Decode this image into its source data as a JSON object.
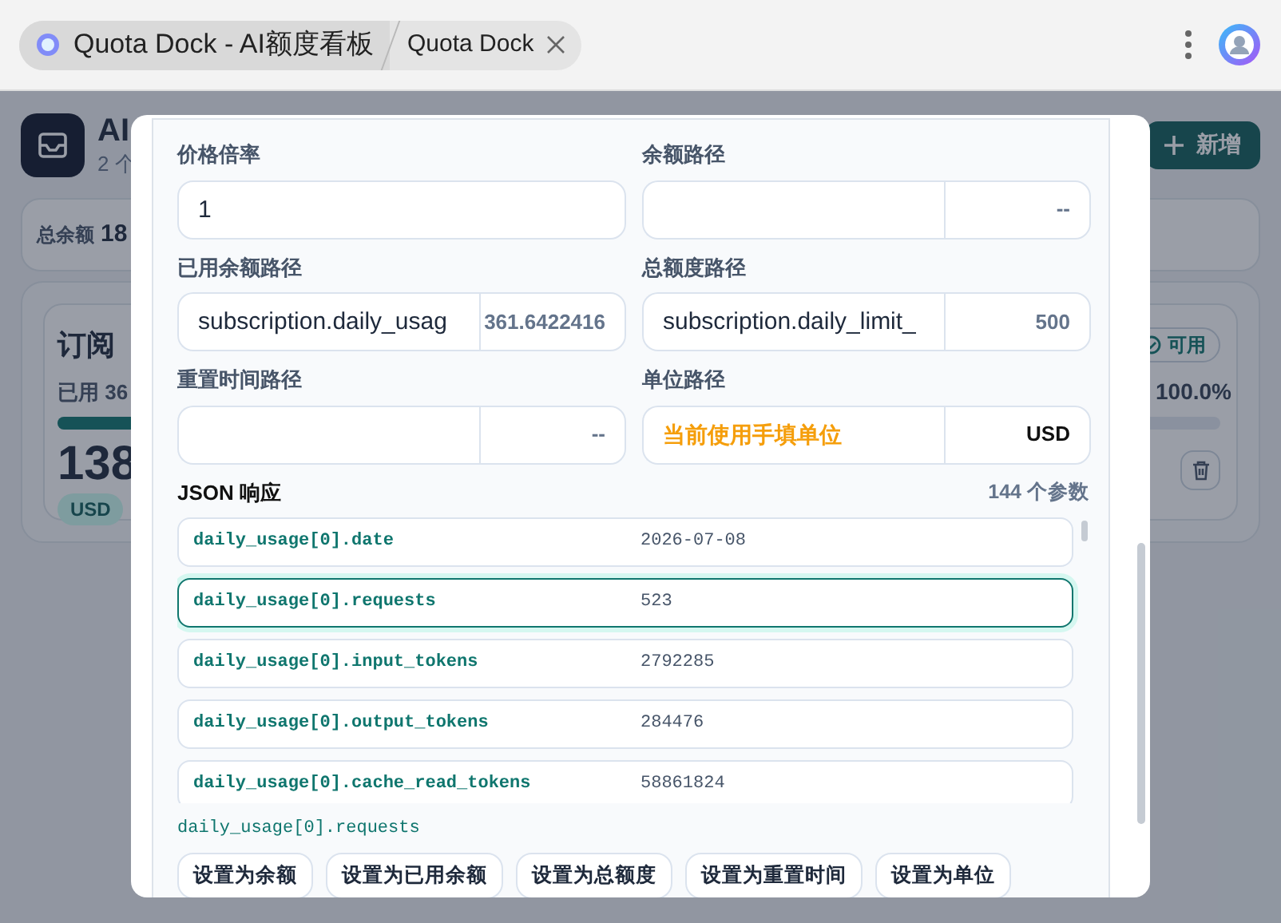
{
  "browser": {
    "tabs": [
      {
        "title": "Quota Dock - AI额度看板",
        "selected": true,
        "closable": false
      },
      {
        "title": "Quota Dock",
        "selected": false,
        "closable": true
      }
    ]
  },
  "app": {
    "title": "AI",
    "subtitle": "2 个",
    "add_button": "新增",
    "summary": {
      "label": "总余额",
      "value": "18"
    },
    "card": {
      "name": "订阅",
      "status": "可用",
      "used": "已用 36",
      "percent": "100.0%",
      "level": 0.72,
      "amount": "138",
      "unit": "USD"
    }
  },
  "modal": {
    "fields": [
      {
        "label": "价格倍率",
        "kind": "input",
        "value": "1"
      },
      {
        "label": "余额路径",
        "kind": "path",
        "preview": "--"
      },
      {
        "label": "已用余额路径",
        "kind": "path",
        "path": "subscription.daily_usag",
        "preview": "361.6422416"
      },
      {
        "label": "总额度路径",
        "kind": "path",
        "path": "subscription.daily_limit_",
        "preview": "500"
      },
      {
        "label": "重置时间路径",
        "kind": "path",
        "preview": "--"
      },
      {
        "label": "单位路径",
        "kind": "note",
        "note": "当前使用手填单位",
        "preview": "USD"
      }
    ],
    "json": {
      "title": "JSON 响应",
      "count": "144 个参数",
      "rows": [
        {
          "key": "daily_usage[0].date",
          "value": "2026-07-08",
          "selected": false
        },
        {
          "key": "daily_usage[0].requests",
          "value": "523",
          "selected": true
        },
        {
          "key": "daily_usage[0].input_tokens",
          "value": "2792285",
          "selected": false
        },
        {
          "key": "daily_usage[0].output_tokens",
          "value": "284476",
          "selected": false
        },
        {
          "key": "daily_usage[0].cache_read_tokens",
          "value": "58861824",
          "selected": false
        }
      ]
    },
    "selected_path": "daily_usage[0].requests",
    "buttons": [
      "设置为余额",
      "设置为已用余额",
      "设置为总额度",
      "设置为重置时间",
      "设置为单位"
    ]
  }
}
